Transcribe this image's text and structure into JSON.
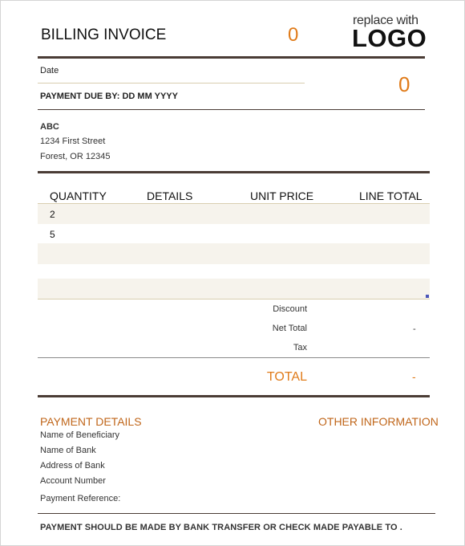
{
  "header": {
    "title": "BILLING INVOICE",
    "invoice_number": "0",
    "logo_line1": "replace with",
    "logo_line2": "LOGO"
  },
  "meta": {
    "date_label": "Date",
    "payment_due": "PAYMENT DUE BY: DD MM YYYY",
    "due_value": "0"
  },
  "address": {
    "name": "ABC",
    "street": "1234 First Street",
    "city_state_zip": "Forest,  OR 12345"
  },
  "table": {
    "columns": [
      "QUANTITY",
      "DETAILS",
      "UNIT PRICE",
      "LINE TOTAL"
    ],
    "rows": [
      {
        "quantity": "2",
        "details": "",
        "unit_price": "",
        "line_total": ""
      },
      {
        "quantity": "5",
        "details": "",
        "unit_price": "",
        "line_total": ""
      },
      {
        "quantity": "",
        "details": "",
        "unit_price": "",
        "line_total": ""
      },
      {
        "quantity": "",
        "details": "",
        "unit_price": "",
        "line_total": ""
      }
    ]
  },
  "summary": {
    "discount_label": "Discount",
    "discount_value": "",
    "net_total_label": "Net Total",
    "net_total_value": "-",
    "tax_label": "Tax",
    "tax_value": "",
    "total_label": "TOTAL",
    "total_value": "-"
  },
  "payment_details": {
    "heading": "PAYMENT DETAILS",
    "beneficiary_label": "Name of Beneficiary",
    "bank_label": "Name of Bank",
    "bank_address_label": "Address of Bank",
    "account_label": "Account Number",
    "reference_label": "Payment Reference:"
  },
  "other_information": {
    "heading": "OTHER INFORMATION"
  },
  "footer": {
    "note": "PAYMENT SHOULD BE MADE BY BANK TRANSFER OR CHECK MADE PAYABLE TO ."
  },
  "colors": {
    "accent_orange": "#e07b1a",
    "heading_orange": "#c0661a",
    "rule_dark": "#4a3c35",
    "row_shade": "#f6f3ec"
  }
}
